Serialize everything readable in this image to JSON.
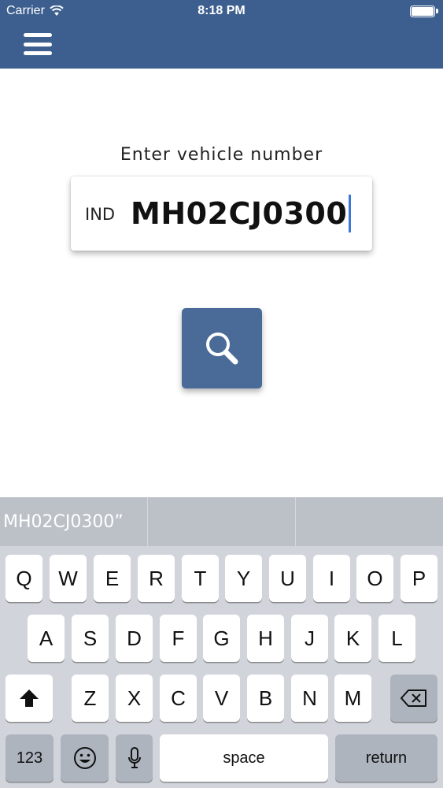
{
  "status_bar": {
    "carrier": "Carrier",
    "time": "8:18 PM",
    "wifi_icon": "wifi-icon",
    "battery_icon": "battery-icon"
  },
  "header": {
    "menu_icon": "hamburger-menu-icon",
    "color": "#3d5f8f"
  },
  "form": {
    "prompt": "Enter vehicle number",
    "prefix": "IND",
    "vehicle_number": "MH02CJ0300",
    "search_icon": "search-icon",
    "button_color": "#4a6a98"
  },
  "keyboard": {
    "suggestions": [
      "MH02CJ0300”",
      "",
      ""
    ],
    "row1": [
      "Q",
      "W",
      "E",
      "R",
      "T",
      "Y",
      "U",
      "I",
      "O",
      "P"
    ],
    "row2": [
      "A",
      "S",
      "D",
      "F",
      "G",
      "H",
      "J",
      "K",
      "L"
    ],
    "row3": [
      "Z",
      "X",
      "C",
      "V",
      "B",
      "N",
      "M"
    ],
    "shift_icon": "shift-icon",
    "delete_icon": "delete-icon",
    "numbers_label": "123",
    "emoji_icon": "emoji-icon",
    "mic_icon": "microphone-icon",
    "space_label": "space",
    "return_label": "return"
  }
}
